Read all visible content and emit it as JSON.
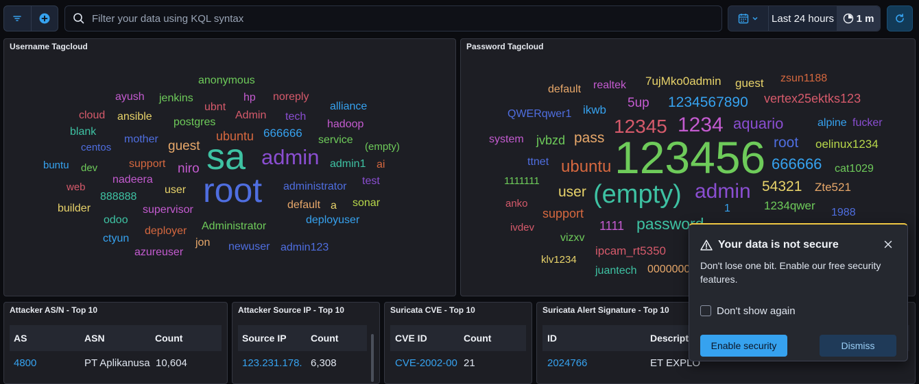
{
  "toolbar": {
    "kql_placeholder": "Filter your data using KQL syntax",
    "time_range": "Last 24 hours",
    "refresh_interval": "1 m"
  },
  "panels": {
    "username_title": "Username Tagcloud",
    "password_title": "Password Tagcloud",
    "asn_title": "Attacker AS/N - Top 10",
    "src_ip_title": "Attacker Source IP - Top 10",
    "cve_title": "Suricata CVE - Top 10",
    "alert_title": "Suricata Alert Signature - Top 10"
  },
  "username_words": [
    {
      "text": "anonymous",
      "color": "#6ecb5a"
    },
    {
      "text": "ayush",
      "color": "#c45bd0"
    },
    {
      "text": "jenkins",
      "color": "#6ecb5a"
    },
    {
      "text": "hp",
      "color": "#c45bd0"
    },
    {
      "text": "noreply",
      "color": "#d65a6b"
    },
    {
      "text": "ubnt",
      "color": "#d65a6b"
    },
    {
      "text": "cloud",
      "color": "#d65a6b"
    },
    {
      "text": "ansible",
      "color": "#e8d36a"
    },
    {
      "text": "Admin",
      "color": "#d65a6b"
    },
    {
      "text": "tech",
      "color": "#8a4ed1"
    },
    {
      "text": "alliance",
      "color": "#36a2ef"
    },
    {
      "text": "postgres",
      "color": "#6ecb5a"
    },
    {
      "text": "blank",
      "color": "#3ec2a3"
    },
    {
      "text": "hadoop",
      "color": "#c45bd0"
    },
    {
      "text": "mother",
      "color": "#4f6ee0"
    },
    {
      "text": "ubuntu",
      "color": "#d6683f"
    },
    {
      "text": "666666",
      "color": "#36a2ef"
    },
    {
      "text": "service",
      "color": "#6ecb5a"
    },
    {
      "text": "centos",
      "color": "#4f6ee0"
    },
    {
      "text": "guest",
      "color": "#e8a86a"
    },
    {
      "text": "(empty)",
      "color": "#6ecb5a"
    },
    {
      "text": "sa",
      "color": "#3ec2a3"
    },
    {
      "text": "admin",
      "color": "#8a4ed1"
    },
    {
      "text": "buntu",
      "color": "#36a2ef"
    },
    {
      "text": "dev",
      "color": "#6ecb5a"
    },
    {
      "text": "support",
      "color": "#d6683f"
    },
    {
      "text": "niro",
      "color": "#c45bd0"
    },
    {
      "text": "admin1",
      "color": "#3ec2a3"
    },
    {
      "text": "ai",
      "color": "#d6683f"
    },
    {
      "text": "nadeera",
      "color": "#c45bd0"
    },
    {
      "text": "test",
      "color": "#8a4ed1"
    },
    {
      "text": "web",
      "color": "#d65a6b"
    },
    {
      "text": "root",
      "color": "#4f6ee0"
    },
    {
      "text": "administrator",
      "color": "#4f6ee0"
    },
    {
      "text": "user",
      "color": "#e8d36a"
    },
    {
      "text": "888888",
      "color": "#3ec2a3"
    },
    {
      "text": "builder",
      "color": "#e8d36a"
    },
    {
      "text": "default",
      "color": "#e8a86a"
    },
    {
      "text": "a",
      "color": "#e8d36a"
    },
    {
      "text": "sonar",
      "color": "#b8d84a"
    },
    {
      "text": "supervisor",
      "color": "#c45bd0"
    },
    {
      "text": "odoo",
      "color": "#3ec2a3"
    },
    {
      "text": "deployuser",
      "color": "#36a2ef"
    },
    {
      "text": "Administrator",
      "color": "#6ecb5a"
    },
    {
      "text": "deployer",
      "color": "#d6683f"
    },
    {
      "text": "ctyun",
      "color": "#36a2ef"
    },
    {
      "text": "jon",
      "color": "#e8a86a"
    },
    {
      "text": "newuser",
      "color": "#4f6ee0"
    },
    {
      "text": "admin123",
      "color": "#4f6ee0"
    },
    {
      "text": "azureuser",
      "color": "#c45bd0"
    }
  ],
  "password_words": [
    {
      "text": "7ujMko0admin",
      "color": "#e8d36a"
    },
    {
      "text": "zsun1188",
      "color": "#d6683f"
    },
    {
      "text": "realtek",
      "color": "#c45bd0"
    },
    {
      "text": "guest",
      "color": "#e8d36a"
    },
    {
      "text": "default",
      "color": "#e8a86a"
    },
    {
      "text": "5up",
      "color": "#c45bd0"
    },
    {
      "text": "1234567890",
      "color": "#36a2ef"
    },
    {
      "text": "vertex25ektks123",
      "color": "#d65a6b"
    },
    {
      "text": "QWERqwer1",
      "color": "#4f6ee0"
    },
    {
      "text": "ikwb",
      "color": "#36a2ef"
    },
    {
      "text": "12345",
      "color": "#d65a6b"
    },
    {
      "text": "1234",
      "color": "#c45bd0"
    },
    {
      "text": "aquario",
      "color": "#8a4ed1"
    },
    {
      "text": "alpine",
      "color": "#36a2ef"
    },
    {
      "text": "fucker",
      "color": "#8a4ed1"
    },
    {
      "text": "system",
      "color": "#c45bd0"
    },
    {
      "text": "jvbzd",
      "color": "#6ecb5a"
    },
    {
      "text": "pass",
      "color": "#e8a86a"
    },
    {
      "text": "123456",
      "color": "#6ecb5a"
    },
    {
      "text": "root",
      "color": "#4f6ee0"
    },
    {
      "text": "oelinux1234",
      "color": "#b8d84a"
    },
    {
      "text": "ttnet",
      "color": "#4f6ee0"
    },
    {
      "text": "ubuntu",
      "color": "#d6683f"
    },
    {
      "text": "666666",
      "color": "#36a2ef"
    },
    {
      "text": "cat1029",
      "color": "#6ecb5a"
    },
    {
      "text": "1111111",
      "color": "#6ecb5a"
    },
    {
      "text": "54321",
      "color": "#e8d36a"
    },
    {
      "text": "Zte521",
      "color": "#e8a86a"
    },
    {
      "text": "user",
      "color": "#e8d36a"
    },
    {
      "text": "(empty)",
      "color": "#3ec2a3"
    },
    {
      "text": "admin",
      "color": "#8a4ed1"
    },
    {
      "text": "anko",
      "color": "#d65a6b"
    },
    {
      "text": "1234qwer",
      "color": "#6ecb5a"
    },
    {
      "text": "1",
      "color": "#36a2ef"
    },
    {
      "text": "1988",
      "color": "#4f6ee0"
    },
    {
      "text": "support",
      "color": "#d6683f"
    },
    {
      "text": "ivdev",
      "color": "#d65a6b"
    },
    {
      "text": "1111",
      "color": "#c45bd0"
    },
    {
      "text": "password",
      "color": "#3ec2a3"
    },
    {
      "text": "vizxv",
      "color": "#6ecb5a"
    },
    {
      "text": "ipcam_rt5350",
      "color": "#d65a6b"
    },
    {
      "text": "klv1234",
      "color": "#e8d36a"
    },
    {
      "text": "juantech",
      "color": "#3ec2a3"
    },
    {
      "text": "0000000",
      "color": "#e8a86a"
    }
  ],
  "asn_table": {
    "headers": [
      "AS",
      "ASN",
      "Count"
    ],
    "row": [
      "4800",
      "PT Aplikanusa",
      "10,604"
    ]
  },
  "src_ip_table": {
    "headers": [
      "Source IP",
      "Count"
    ],
    "row": [
      "123.231.178.",
      "6,308"
    ]
  },
  "cve_table": {
    "headers": [
      "CVE ID",
      "Count"
    ],
    "row": [
      "CVE-2002-00",
      "21"
    ]
  },
  "alert_table": {
    "headers": [
      "ID",
      "Descript"
    ],
    "row": [
      "2024766",
      "ET EXPLO"
    ]
  },
  "toast": {
    "title": "Your data is not secure",
    "message": "Don't lose one bit. Enable our free security features.",
    "checkbox_label": "Don't show again",
    "enable_label": "Enable security",
    "dismiss_label": "Dismiss"
  },
  "colors": {
    "accent": "#36a2ef",
    "warning": "#f0c843",
    "background": "#0b0c10",
    "panel": "#1d1e24"
  },
  "icons": [
    "filter-icon",
    "add-filter-icon",
    "search-icon",
    "calendar-icon",
    "chevron-down-icon",
    "timer-icon",
    "refresh-icon",
    "warning-icon",
    "close-icon"
  ]
}
